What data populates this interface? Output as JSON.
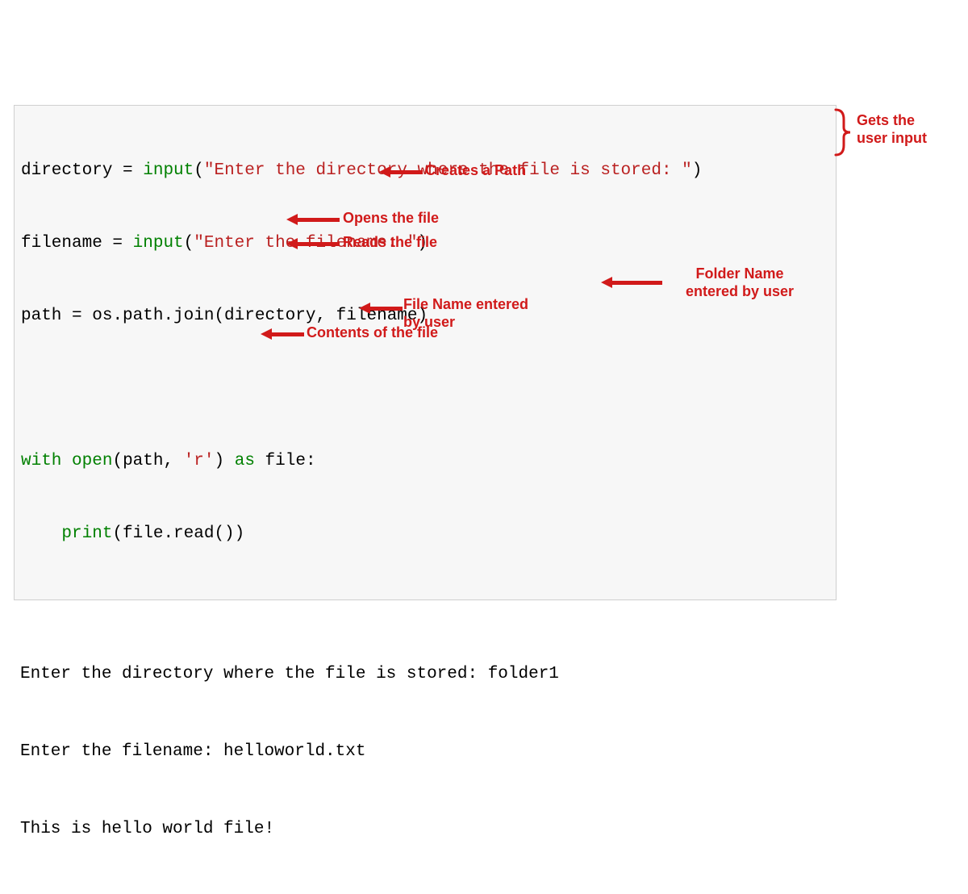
{
  "code": {
    "l1": {
      "var": "directory ",
      "eq": "= ",
      "fn": "input",
      "paren_open": "(",
      "str": "\"Enter the directory where the file is stored: \"",
      "paren_close": ")"
    },
    "l2": {
      "var": "filename ",
      "eq": "= ",
      "fn": "input",
      "paren_open": "(",
      "str": "\"Enter the filename: \"",
      "paren_close": ")"
    },
    "l3": {
      "var": "path ",
      "eq": "= ",
      "rest": "os.path.join(directory, filename)"
    },
    "blank": " ",
    "l4": {
      "w": "with",
      "sp1": " ",
      "fn": "open",
      "paren_open": "(",
      "arg1": "path, ",
      "str": "'r'",
      "paren_close_as": ") ",
      "askw": "as",
      "sp2": " ",
      "filevar": "file:"
    },
    "l5": {
      "indent": "    ",
      "fn": "print",
      "rest": "(file.read())"
    }
  },
  "output": {
    "l1": "Enter the directory where the file is stored: folder1",
    "l2": "Enter the filename: helloworld.txt",
    "l3": "This is hello world file!"
  },
  "ann": {
    "gets_input": "Gets the\nuser input",
    "creates_path": "Creates a Path",
    "opens_file": "Opens the file",
    "reads_file": "Reads the file",
    "folder_name": "Folder Name\nentered by user",
    "file_name": "File Name entered\nby user",
    "contents": "Contents of the file"
  }
}
